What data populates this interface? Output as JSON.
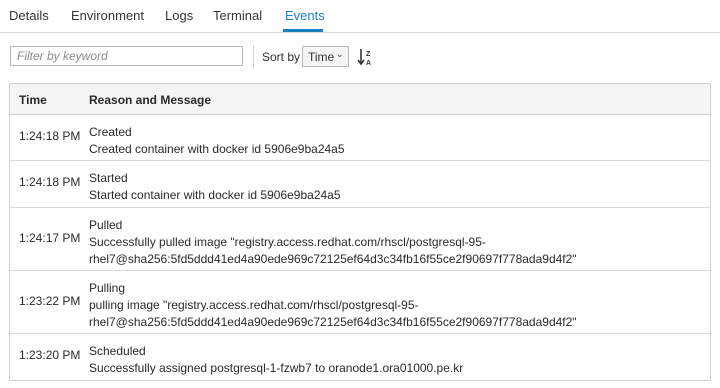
{
  "tabs": [
    {
      "label": "Details"
    },
    {
      "label": "Environment"
    },
    {
      "label": "Logs"
    },
    {
      "label": "Terminal"
    },
    {
      "label": "Events",
      "active": true
    }
  ],
  "filter": {
    "placeholder": "Filter by keyword",
    "value": ""
  },
  "sort": {
    "label": "Sort by",
    "selected": "Time",
    "direction_icon": "sort-alpha-desc-icon"
  },
  "table": {
    "headers": {
      "time": "Time",
      "message": "Reason and Message"
    },
    "rows": [
      {
        "time": "1:24:18 PM",
        "reason": "Created",
        "message": [
          "Created container with docker id 5906e9ba24a5"
        ]
      },
      {
        "time": "1:24:18 PM",
        "reason": "Started",
        "message": [
          "Started container with docker id 5906e9ba24a5"
        ]
      },
      {
        "time": "1:24:17 PM",
        "reason": "Pulled",
        "message": [
          "Successfully pulled image \"registry.access.redhat.com/rhscl/postgresql-95-",
          "rhel7@sha256:5fd5ddd41ed4a90ede969c72125ef64d3c34fb16f55ce2f90697f778ada9d4f2\""
        ]
      },
      {
        "time": "1:23:22 PM",
        "reason": "Pulling",
        "message": [
          "pulling image \"registry.access.redhat.com/rhscl/postgresql-95-",
          "rhel7@sha256:5fd5ddd41ed4a90ede969c72125ef64d3c34fb16f55ce2f90697f778ada9d4f2\""
        ]
      },
      {
        "time": "1:23:20 PM",
        "reason": "Scheduled",
        "message": [
          "Successfully assigned postgresql-1-fzwb7 to oranode1.ora01000.pe.kr"
        ]
      }
    ]
  },
  "colors": {
    "accent": "#1b7fc4",
    "header_bg": "#f5f5f5",
    "border": "#d1d1d1"
  }
}
